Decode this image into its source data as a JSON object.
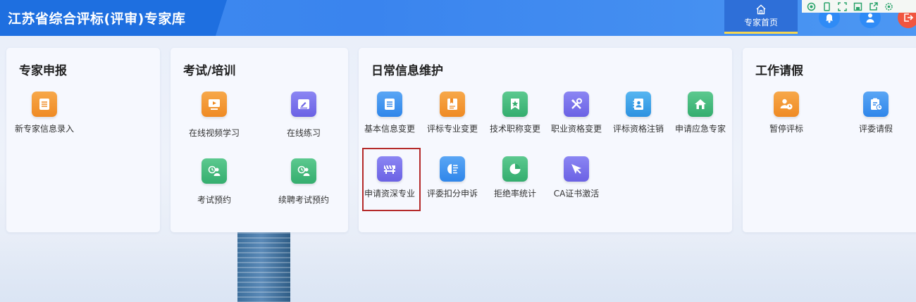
{
  "header": {
    "app_title": "江苏省综合评标(评审)专家库",
    "home_tab_label": "专家首页"
  },
  "colors": {
    "header_blue": "#3f8cf0",
    "title_block": "#1e6fe0",
    "active_underline": "#f6d64f",
    "highlight_border": "#b52a2a"
  },
  "cards": [
    {
      "title": "专家申报",
      "tiles": [
        {
          "label": "新专家信息录入",
          "icon": "list-icon"
        }
      ]
    },
    {
      "title": "考试/培训",
      "tiles": [
        {
          "label": "在线视频学习",
          "icon": "video-icon"
        },
        {
          "label": "在线练习",
          "icon": "edit-icon"
        },
        {
          "label": "考试预约",
          "icon": "user-clock-icon"
        },
        {
          "label": "续聘考试预约",
          "icon": "user-clock-icon"
        }
      ]
    },
    {
      "title": "日常信息维护",
      "tiles": [
        {
          "label": "基本信息变更",
          "icon": "list-icon"
        },
        {
          "label": "评标专业变更",
          "icon": "document-icon"
        },
        {
          "label": "技术职称变更",
          "icon": "badge-icon"
        },
        {
          "label": "职业资格变更",
          "icon": "tools-icon"
        },
        {
          "label": "评标资格注销",
          "icon": "contact-book-icon"
        },
        {
          "label": "申请应急专家",
          "icon": "home-icon"
        },
        {
          "label": "申请资深专业",
          "icon": "barrier-icon"
        },
        {
          "label": "评委扣分申诉",
          "icon": "brain-icon"
        },
        {
          "label": "拒绝率统计",
          "icon": "pie-chart-icon"
        },
        {
          "label": "CA证书激活",
          "icon": "cursor-icon"
        }
      ]
    },
    {
      "title": "工作请假",
      "tiles": [
        {
          "label": "暂停评标",
          "icon": "user-pause-icon"
        },
        {
          "label": "评委请假",
          "icon": "clipboard-clock-icon"
        }
      ]
    }
  ]
}
